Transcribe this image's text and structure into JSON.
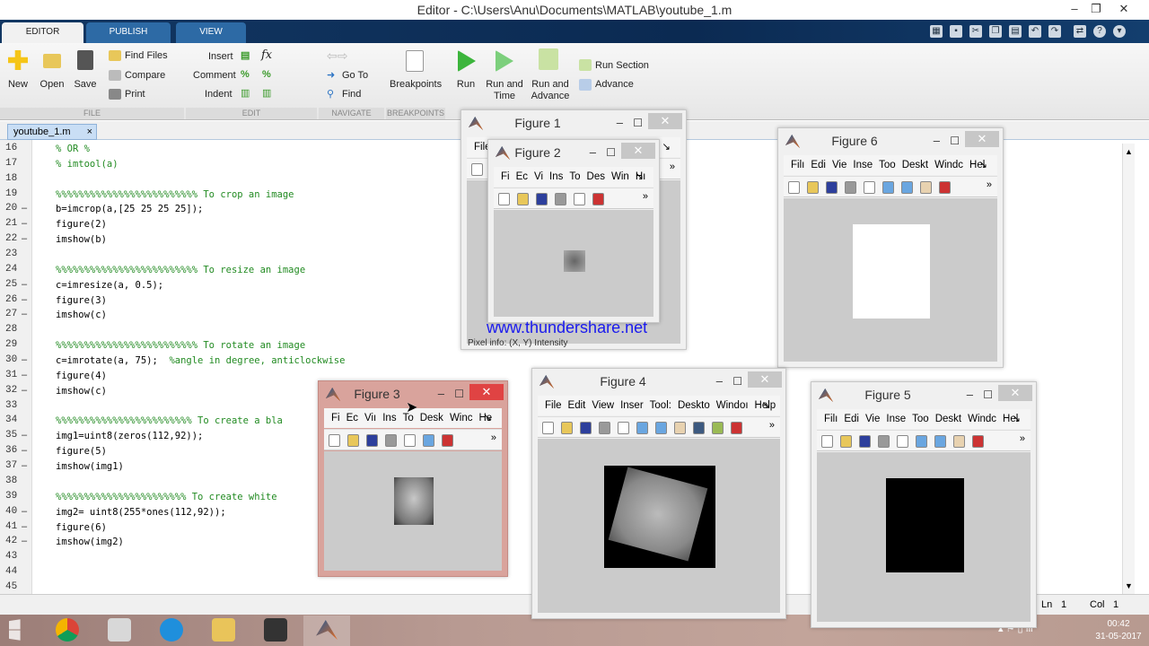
{
  "window": {
    "title": "Editor - C:\\Users\\Anu\\Documents\\MATLAB\\youtube_1.m",
    "minimize": "–",
    "restore": "❐",
    "close": "✕"
  },
  "ribbon_tabs": [
    "EDITOR",
    "PUBLISH",
    "VIEW"
  ],
  "ribbon": {
    "new": "New",
    "open": "Open",
    "save": "Save",
    "find_files": "Find Files",
    "compare": "Compare",
    "print": "Print",
    "insert": "Insert",
    "comment": "Comment",
    "indent": "Indent",
    "go_to": "Go To",
    "find": "Find",
    "breakpoints": "Breakpoints",
    "run": "Run",
    "run_and_time": "Run and Time",
    "run_and_advance": "Run and Advance",
    "run_section": "Run Section",
    "advance": "Advance",
    "sections": [
      "FILE",
      "EDIT",
      "NAVIGATE",
      "BREAKPOINTS"
    ]
  },
  "doc_tab": {
    "name": "youtube_1.m",
    "close": "×"
  },
  "code": [
    {
      "n": "16",
      "d": "",
      "s": [
        {
          "t": "% OR %",
          "c": 1
        }
      ]
    },
    {
      "n": "17",
      "d": "",
      "s": [
        {
          "t": "% imtool(a)",
          "c": 1
        }
      ]
    },
    {
      "n": "18",
      "d": "",
      "s": []
    },
    {
      "n": "19",
      "d": "",
      "s": [
        {
          "t": "%%%%%%%%%%%%%%%%%%%%%%%%% To crop an image",
          "c": 1
        }
      ]
    },
    {
      "n": "20",
      "d": "–",
      "s": [
        {
          "t": "b=imcrop(a,[25 25 25 25]);",
          "c": 0
        }
      ]
    },
    {
      "n": "21",
      "d": "–",
      "s": [
        {
          "t": "figure(2)",
          "c": 0
        }
      ]
    },
    {
      "n": "22",
      "d": "–",
      "s": [
        {
          "t": "imshow(b)",
          "c": 0
        }
      ]
    },
    {
      "n": "23",
      "d": "",
      "s": []
    },
    {
      "n": "24",
      "d": "",
      "s": [
        {
          "t": "%%%%%%%%%%%%%%%%%%%%%%%%% To resize an image",
          "c": 1
        }
      ]
    },
    {
      "n": "25",
      "d": "–",
      "s": [
        {
          "t": "c=imresize(a, 0.5);",
          "c": 0
        }
      ]
    },
    {
      "n": "26",
      "d": "–",
      "s": [
        {
          "t": "figure(3)",
          "c": 0
        }
      ]
    },
    {
      "n": "27",
      "d": "–",
      "s": [
        {
          "t": "imshow(c)",
          "c": 0
        }
      ]
    },
    {
      "n": "28",
      "d": "",
      "s": []
    },
    {
      "n": "29",
      "d": "",
      "s": [
        {
          "t": "%%%%%%%%%%%%%%%%%%%%%%%%% To rotate an image",
          "c": 1
        }
      ]
    },
    {
      "n": "30",
      "d": "–",
      "s": [
        {
          "t": "c=imrotate(a, 75);  ",
          "c": 0
        },
        {
          "t": "%angle in degree, anticlockwise",
          "c": 1
        }
      ]
    },
    {
      "n": "31",
      "d": "–",
      "s": [
        {
          "t": "figure(4)",
          "c": 0
        }
      ]
    },
    {
      "n": "32",
      "d": "–",
      "s": [
        {
          "t": "imshow(c)",
          "c": 0
        }
      ]
    },
    {
      "n": "33",
      "d": "",
      "s": []
    },
    {
      "n": "34",
      "d": "",
      "s": [
        {
          "t": "%%%%%%%%%%%%%%%%%%%%%%%% To create a bla",
          "c": 1
        }
      ]
    },
    {
      "n": "35",
      "d": "–",
      "s": [
        {
          "t": "img1=uint8(zeros(112,92));",
          "c": 0
        }
      ]
    },
    {
      "n": "36",
      "d": "–",
      "s": [
        {
          "t": "figure(5)",
          "c": 0
        }
      ]
    },
    {
      "n": "37",
      "d": "–",
      "s": [
        {
          "t": "imshow(img1)",
          "c": 0
        }
      ]
    },
    {
      "n": "38",
      "d": "",
      "s": []
    },
    {
      "n": "39",
      "d": "",
      "s": [
        {
          "t": "%%%%%%%%%%%%%%%%%%%%%%% To create white",
          "c": 1
        }
      ]
    },
    {
      "n": "40",
      "d": "–",
      "s": [
        {
          "t": "img2= uint8(255*ones(112,92));",
          "c": 0
        }
      ]
    },
    {
      "n": "41",
      "d": "–",
      "s": [
        {
          "t": "figure(6)",
          "c": 0
        }
      ]
    },
    {
      "n": "42",
      "d": "–",
      "s": [
        {
          "t": "imshow(img2)",
          "c": 0
        }
      ]
    },
    {
      "n": "43",
      "d": "",
      "s": []
    },
    {
      "n": "44",
      "d": "",
      "s": []
    },
    {
      "n": "45",
      "d": "",
      "s": []
    }
  ],
  "status": {
    "ln_label": "Ln",
    "ln": "1",
    "col_label": "Col",
    "col": "1"
  },
  "figures": [
    {
      "id": "1",
      "title": "Figure 1",
      "menu": [
        "File",
        "",
        "",
        "",
        "",
        "",
        "",
        "I"
      ],
      "tools": [
        "new",
        "open"
      ],
      "image": "none",
      "status_text": "Pixel info: (X, Y)  Intensity"
    },
    {
      "id": "2",
      "title": "Figure 2",
      "menu": [
        "Fi",
        "Ec",
        "Vi",
        "Ins",
        "To",
        "Des",
        "Win",
        "Hı"
      ],
      "tools": [
        "new",
        "open",
        "save",
        "print",
        "pointer",
        "brush"
      ],
      "image": "crop"
    },
    {
      "id": "6",
      "title": "Figure 6",
      "menu": [
        "Filı",
        "Edi",
        "Vie",
        "Inse",
        "Too",
        "Deskt",
        "Windc",
        "Hel"
      ],
      "tools": [
        "new",
        "open",
        "save",
        "print",
        "pointer",
        "zoom-in",
        "zoom-out",
        "pan",
        "brush"
      ],
      "image": "white"
    },
    {
      "id": "4",
      "title": "Figure 4",
      "menu": [
        "File",
        "Edit",
        "View",
        "Inser",
        "Tool:",
        "Deskto",
        "Windoı",
        "Help"
      ],
      "tools": [
        "new",
        "open",
        "save",
        "print",
        "pointer",
        "zoom-in",
        "zoom-out",
        "pan",
        "rotate",
        "datacursor",
        "brush"
      ],
      "image": "rotated"
    },
    {
      "id": "5",
      "title": "Figure 5",
      "menu": [
        "Filı",
        "Edi",
        "Vie",
        "Inse",
        "Too",
        "Deskt",
        "Windc",
        "Hel"
      ],
      "tools": [
        "new",
        "open",
        "save",
        "print",
        "pointer",
        "zoom-in",
        "zoom-out",
        "pan",
        "brush"
      ],
      "image": "black"
    },
    {
      "id": "3",
      "title": "Figure 3",
      "menu": [
        "Fi",
        "Ec",
        "Viı",
        "Ins",
        "To",
        "Desk",
        "Winc",
        "He"
      ],
      "tools": [
        "new",
        "open",
        "save",
        "print",
        "pointer",
        "zoom-in",
        "brush"
      ],
      "image": "face",
      "active": true
    }
  ],
  "watermark": "www.thundershare.net",
  "taskbar": {
    "time": "00:42",
    "date": "31-05-2017",
    "apps": [
      "start",
      "chrome",
      "snipping-tool",
      "app-blue",
      "file-explorer",
      "media-app",
      "matlab"
    ]
  }
}
